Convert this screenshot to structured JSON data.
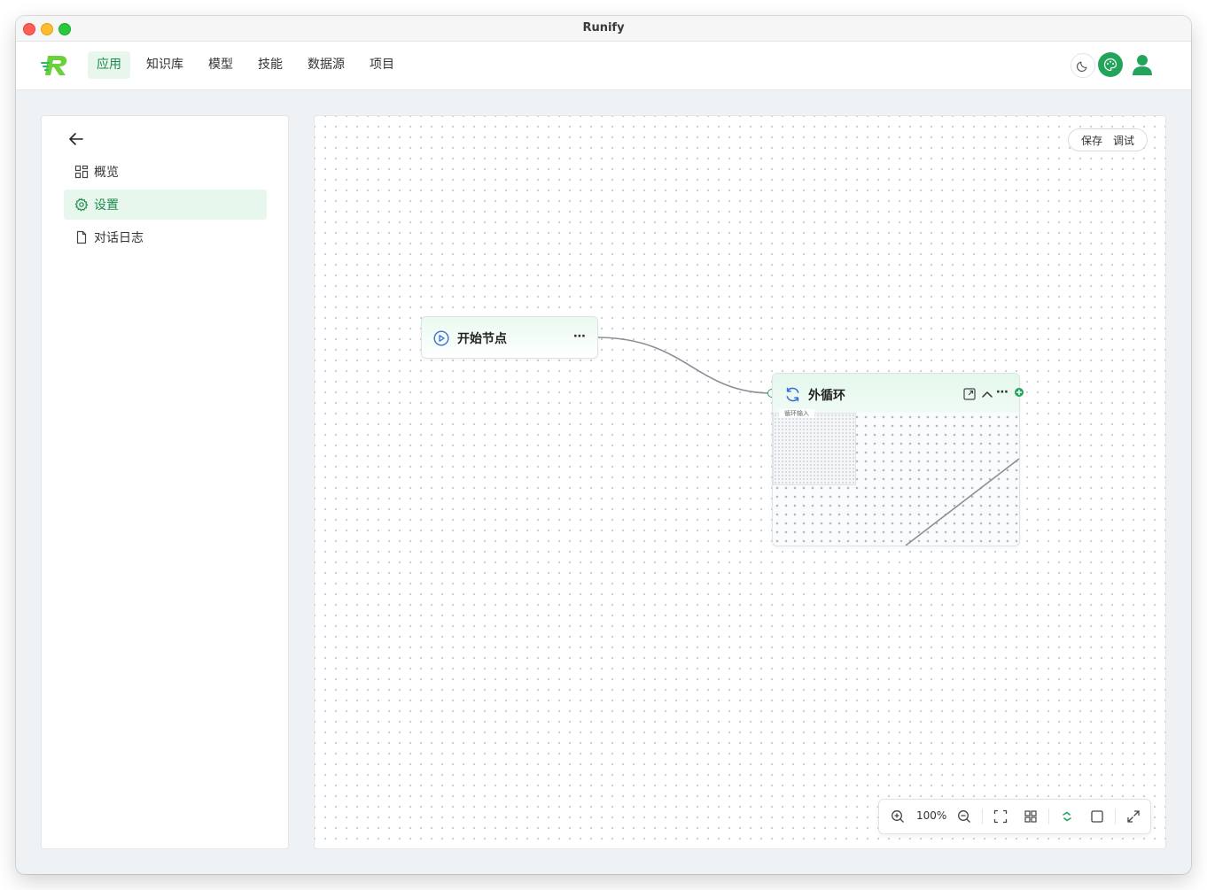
{
  "window": {
    "title": "Runify"
  },
  "topnav": {
    "items": [
      {
        "label": "应用",
        "active": true
      },
      {
        "label": "知识库",
        "active": false
      },
      {
        "label": "模型",
        "active": false
      },
      {
        "label": "技能",
        "active": false
      },
      {
        "label": "数据源",
        "active": false
      },
      {
        "label": "项目",
        "active": false
      }
    ],
    "icons": [
      "moon-icon",
      "palette-icon",
      "user-avatar-icon"
    ]
  },
  "sidebar": {
    "back_icon": "arrow-left-icon",
    "items": [
      {
        "label": "概览",
        "icon": "grid-icon",
        "active": false
      },
      {
        "label": "设置",
        "icon": "gear-icon",
        "active": true
      },
      {
        "label": "对话日志",
        "icon": "file-icon",
        "active": false
      }
    ]
  },
  "canvas": {
    "actions": {
      "save": "保存",
      "debug": "调试"
    },
    "nodes": {
      "start": {
        "title": "开始节点",
        "icon": "play-circle-icon"
      },
      "loop": {
        "title": "外循环",
        "icon": "refresh-icon",
        "inner_label": "循环输入"
      }
    },
    "toolbar": {
      "zoom": "100%",
      "icons": [
        "zoom-in-icon",
        "zoom-out-icon",
        "fit-view-icon",
        "layout-grid-icon",
        "auto-layout-icon",
        "select-box-icon",
        "fullscreen-icon"
      ]
    }
  },
  "colors": {
    "brand": "#22a55b",
    "active_bg": "#e8f7ee",
    "canvas_dot": "#c9cdd3",
    "edge": "#8a8f98"
  }
}
